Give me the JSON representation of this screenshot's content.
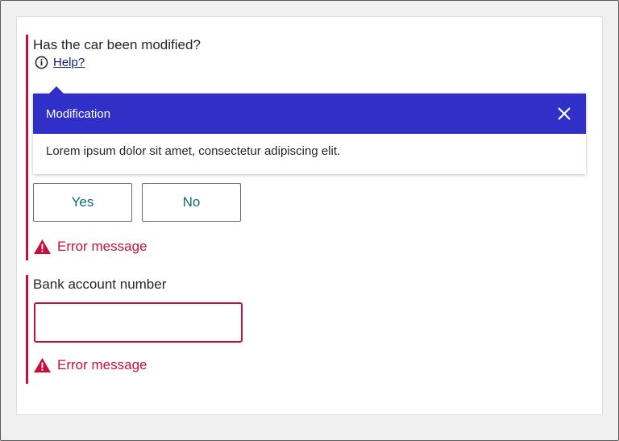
{
  "form": {
    "question1": {
      "label": "Has the car been modified?",
      "help_link": "Help?",
      "popover": {
        "title": "Modification",
        "body": "Lorem ipsum dolor sit amet, consectetur adipiscing elit."
      },
      "options": [
        "Yes",
        "No"
      ],
      "error": "Error message"
    },
    "question2": {
      "label": "Bank account number",
      "value": "",
      "placeholder": "",
      "error": "Error message"
    }
  },
  "colors": {
    "error": "#c3103c",
    "popover_header": "#3030c8",
    "button_text": "#0e6a78",
    "link": "#0f1b70"
  },
  "icons": {
    "help": "info-circle-icon",
    "close": "close-icon",
    "error": "warning-triangle-icon"
  }
}
